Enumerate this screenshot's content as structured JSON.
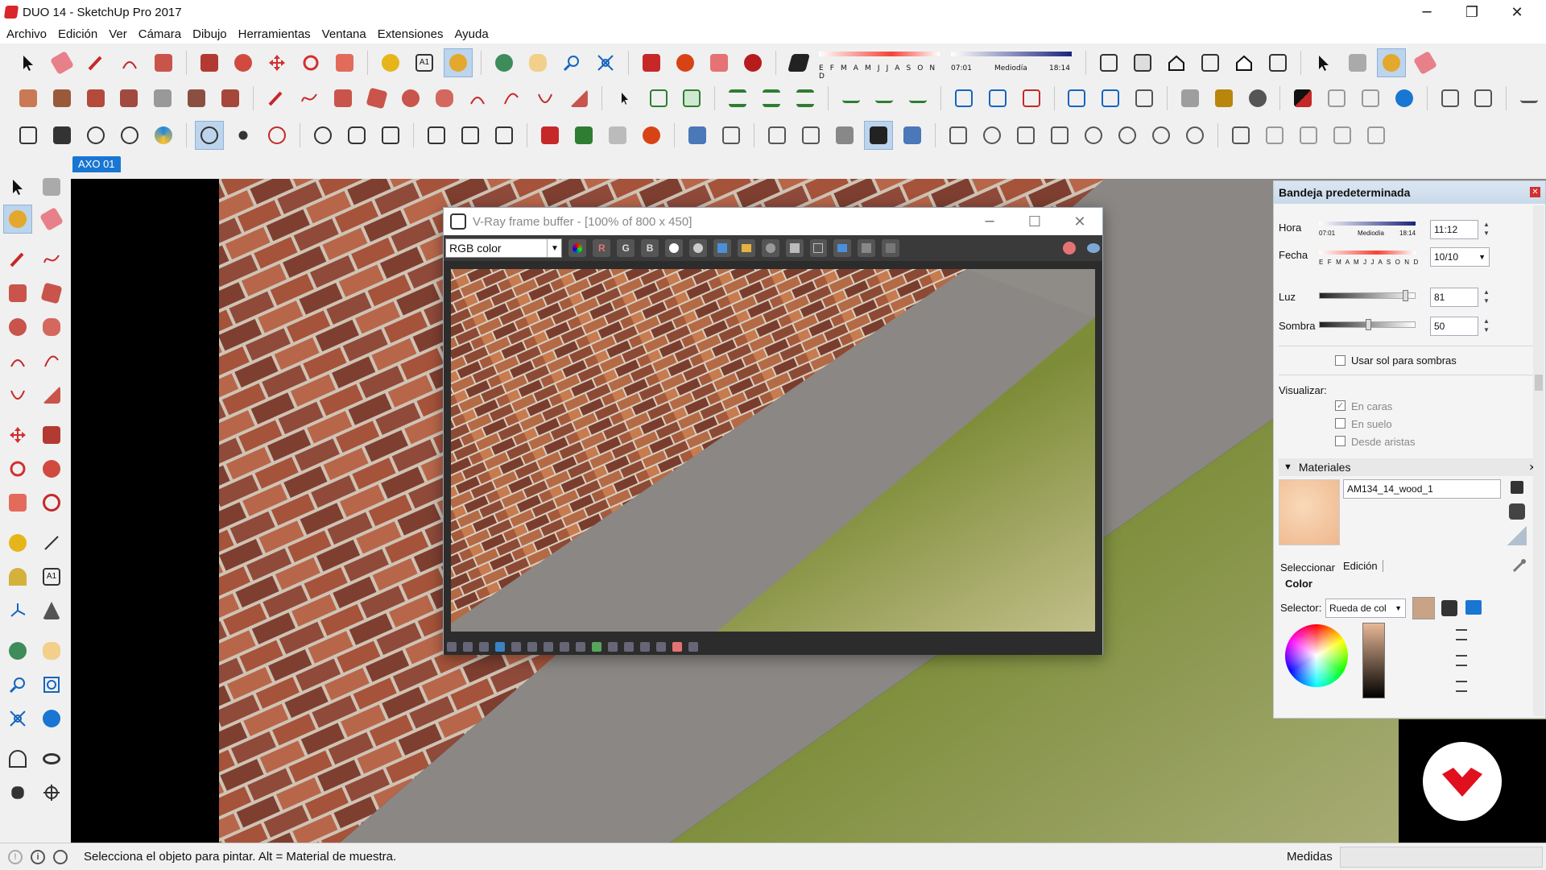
{
  "window": {
    "title": "DUO 14 - SketchUp Pro 2017"
  },
  "menu": [
    "Archivo",
    "Edición",
    "Ver",
    "Cámara",
    "Dibujo",
    "Herramientas",
    "Ventana",
    "Extensiones",
    "Ayuda"
  ],
  "shadow_toolbar": {
    "months": "E F M A M J J A S O N D",
    "time_start": "07:01",
    "time_mid": "Mediodía",
    "time_end": "18:14"
  },
  "scene_tab": "AXO 01",
  "vfb": {
    "title": "V-Ray frame buffer - [100% of 800 x 450]",
    "channel": "RGB color",
    "buttons": {
      "r": "R",
      "g": "G",
      "b": "B"
    }
  },
  "tray": {
    "title": "Bandeja predeterminada",
    "hora_label": "Hora",
    "hora_value": "11:12",
    "hora_scale": {
      "start": "07:01",
      "mid": "Mediodía",
      "end": "18:14"
    },
    "fecha_label": "Fecha",
    "fecha_value": "10/10",
    "fecha_months": "E F M A M J J A S O N D",
    "luz_label": "Luz",
    "luz_value": "81",
    "sombra_label": "Sombra",
    "sombra_value": "50",
    "usar_sol": "Usar sol para sombras",
    "visualizar_label": "Visualizar:",
    "en_caras": "En caras",
    "en_suelo": "En suelo",
    "desde_aristas": "Desde aristas",
    "materiales_title": "Materiales",
    "material_name": "AM134_14_wood_1",
    "tab_seleccionar": "Seleccionar",
    "tab_edicion": "Edición",
    "color_label": "Color",
    "selector_label": "Selector:",
    "selector_value": "Rueda de col"
  },
  "status": {
    "message": "Selecciona el objeto para pintar. Alt = Material de muestra.",
    "measure_label": "Medidas"
  },
  "colors": {
    "accent": "#1976d2",
    "brick": "#a5533a",
    "concrete": "#8a8784",
    "grass": "#8b9a4c",
    "vray_red": "#e0101e"
  }
}
